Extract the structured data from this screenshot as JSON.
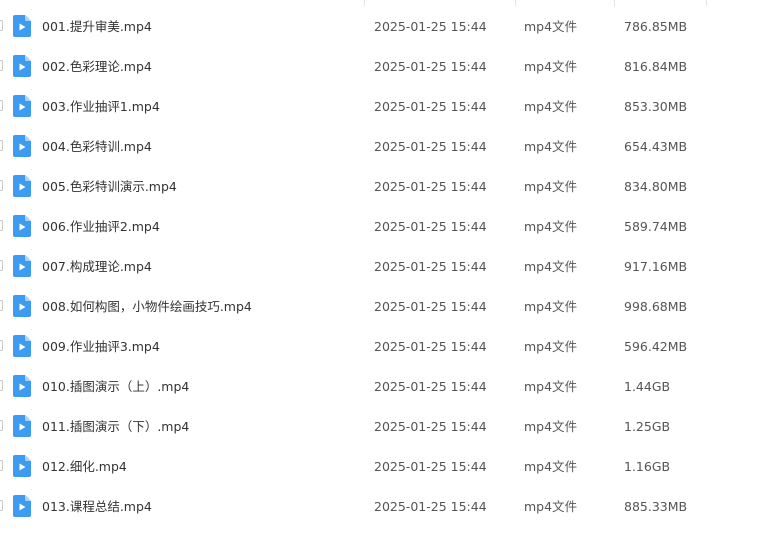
{
  "files": [
    {
      "name": "001.提升审美.mp4",
      "date": "2025-01-25 15:44",
      "type": "mp4文件",
      "size": "786.85MB",
      "icon": "video-file-icon"
    },
    {
      "name": "002.色彩理论.mp4",
      "date": "2025-01-25 15:44",
      "type": "mp4文件",
      "size": "816.84MB",
      "icon": "video-file-icon"
    },
    {
      "name": "003.作业抽评1.mp4",
      "date": "2025-01-25 15:44",
      "type": "mp4文件",
      "size": "853.30MB",
      "icon": "video-file-icon"
    },
    {
      "name": "004.色彩特训.mp4",
      "date": "2025-01-25 15:44",
      "type": "mp4文件",
      "size": "654.43MB",
      "icon": "video-file-icon"
    },
    {
      "name": "005.色彩特训演示.mp4",
      "date": "2025-01-25 15:44",
      "type": "mp4文件",
      "size": "834.80MB",
      "icon": "video-file-icon"
    },
    {
      "name": "006.作业抽评2.mp4",
      "date": "2025-01-25 15:44",
      "type": "mp4文件",
      "size": "589.74MB",
      "icon": "video-file-icon"
    },
    {
      "name": "007.构成理论.mp4",
      "date": "2025-01-25 15:44",
      "type": "mp4文件",
      "size": "917.16MB",
      "icon": "video-file-icon"
    },
    {
      "name": "008.如何构图，小物件绘画技巧.mp4",
      "date": "2025-01-25 15:44",
      "type": "mp4文件",
      "size": "998.68MB",
      "icon": "video-file-icon"
    },
    {
      "name": "009.作业抽评3.mp4",
      "date": "2025-01-25 15:44",
      "type": "mp4文件",
      "size": "596.42MB",
      "icon": "video-file-icon"
    },
    {
      "name": "010.插图演示（上）.mp4",
      "date": "2025-01-25 15:44",
      "type": "mp4文件",
      "size": "1.44GB",
      "icon": "video-file-icon"
    },
    {
      "name": "011.插图演示（下）.mp4",
      "date": "2025-01-25 15:44",
      "type": "mp4文件",
      "size": "1.25GB",
      "icon": "video-file-icon"
    },
    {
      "name": "012.细化.mp4",
      "date": "2025-01-25 15:44",
      "type": "mp4文件",
      "size": "1.16GB",
      "icon": "video-file-icon"
    },
    {
      "name": "013.课程总结.mp4",
      "date": "2025-01-25 15:44",
      "type": "mp4文件",
      "size": "885.33MB",
      "icon": "video-file-icon"
    }
  ],
  "colors": {
    "icon_fill": "#3d9cf0",
    "icon_fold": "#a9d3f8",
    "text": "#333333"
  }
}
